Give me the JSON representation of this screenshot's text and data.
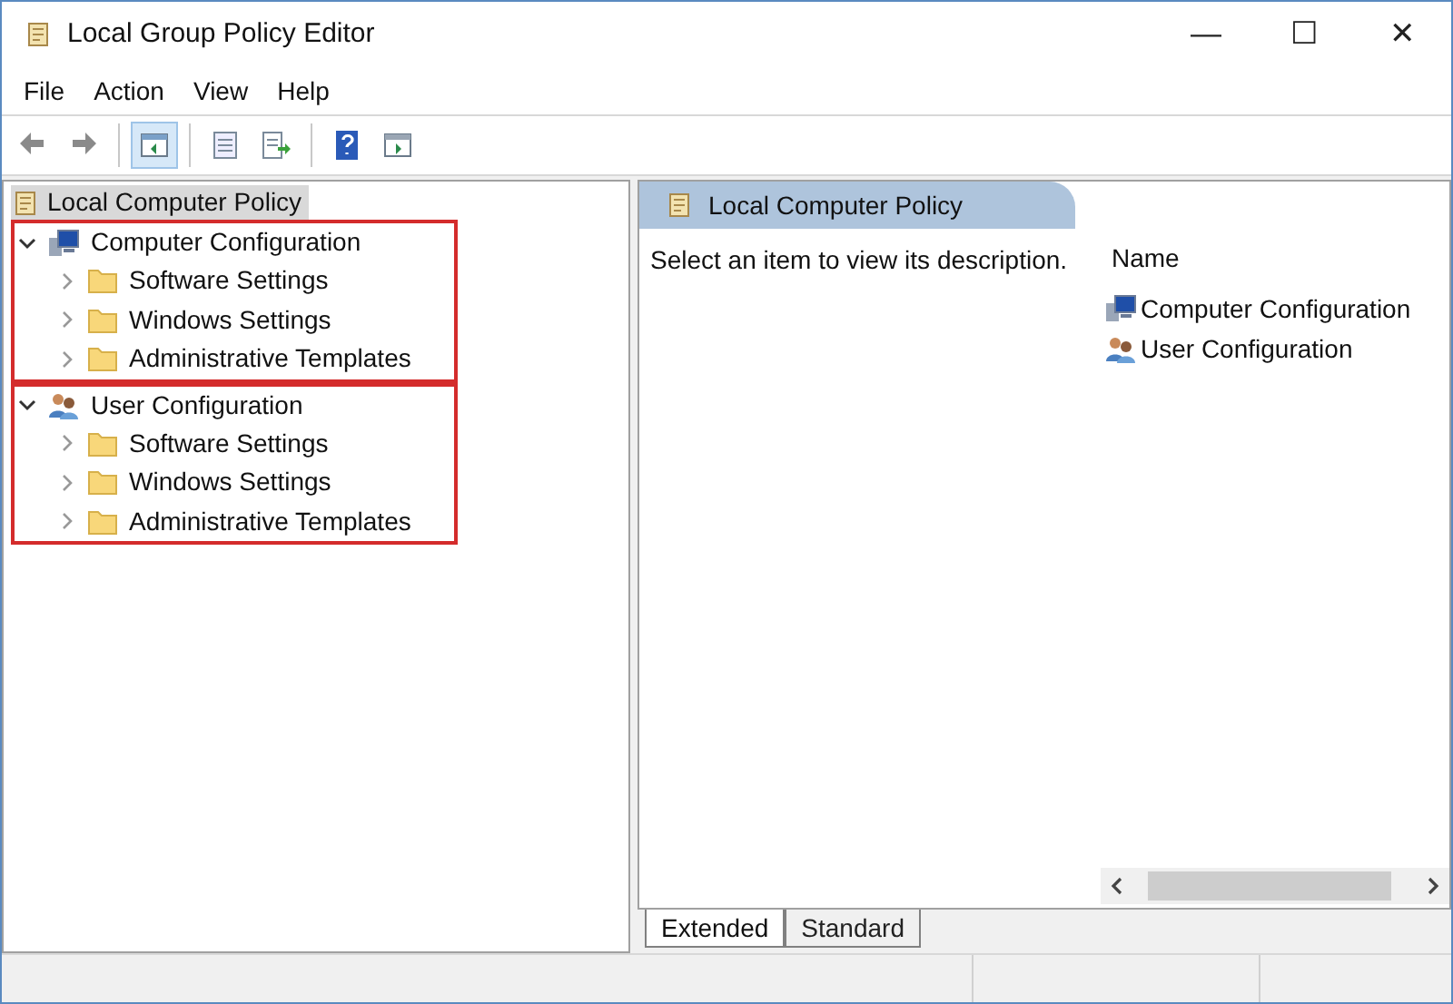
{
  "window": {
    "title": "Local Group Policy Editor",
    "controls": [
      "—",
      "☐",
      "✕"
    ]
  },
  "menu": [
    "File",
    "Action",
    "View",
    "Help"
  ],
  "toolbar": [
    {
      "kind": "back"
    },
    {
      "kind": "forward"
    },
    {
      "kind": "sep"
    },
    {
      "kind": "pane",
      "selected": true
    },
    {
      "kind": "sep"
    },
    {
      "kind": "list",
      "selected": false
    },
    {
      "kind": "export",
      "selected": false
    },
    {
      "kind": "sep"
    },
    {
      "kind": "help",
      "selected": false
    },
    {
      "kind": "pane2",
      "selected": false
    }
  ],
  "tree": {
    "label": "Local Computer Policy",
    "selected": true,
    "children": [
      {
        "label": "Computer Configuration",
        "kind": "computer",
        "expanded": true,
        "highlighted": true,
        "children": [
          {
            "label": "Software Settings",
            "expanded": false
          },
          {
            "label": "Windows Settings",
            "expanded": false
          },
          {
            "label": "Administrative Templates",
            "expanded": false
          }
        ]
      },
      {
        "label": "User Configuration",
        "kind": "user",
        "expanded": true,
        "highlighted": true,
        "children": [
          {
            "label": "Software Settings",
            "expanded": false
          },
          {
            "label": "Windows Settings",
            "expanded": false
          },
          {
            "label": "Administrative Templates",
            "expanded": false
          }
        ]
      }
    ]
  },
  "details": {
    "header": "Local Computer Policy",
    "description": "Select an item to view its description.",
    "column": "Name",
    "items": [
      {
        "label": "Computer Configuration",
        "kind": "computer"
      },
      {
        "label": "User Configuration",
        "kind": "user"
      }
    ]
  },
  "tabs": [
    {
      "label": "Extended",
      "selected": true
    },
    {
      "label": "Standard",
      "selected": false
    }
  ]
}
